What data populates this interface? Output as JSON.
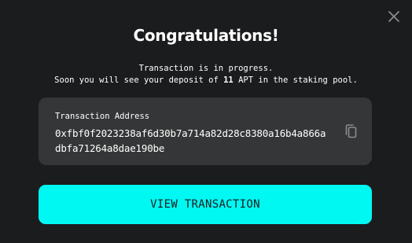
{
  "modal": {
    "title": "Congratulations!",
    "message_line1": "Transaction is in progress.",
    "message_line2_prefix": "Soon you will see your deposit of ",
    "amount": "11",
    "message_line2_suffix": " APT in the staking pool.",
    "close_icon": "close-icon"
  },
  "address_card": {
    "label": "Transaction Address",
    "value": "0xfbf0f2023238af6d30b7a714a82d28c8380a16b4a866adbfa71264a8dae190be",
    "copy_icon": "copy-icon"
  },
  "actions": {
    "view_label": "VIEW TRANSACTION"
  },
  "colors": {
    "background": "#1b1c1d",
    "card": "#353637",
    "accent": "#00f8f3",
    "text": "#ffffff",
    "icon": "#8a8c8e"
  }
}
